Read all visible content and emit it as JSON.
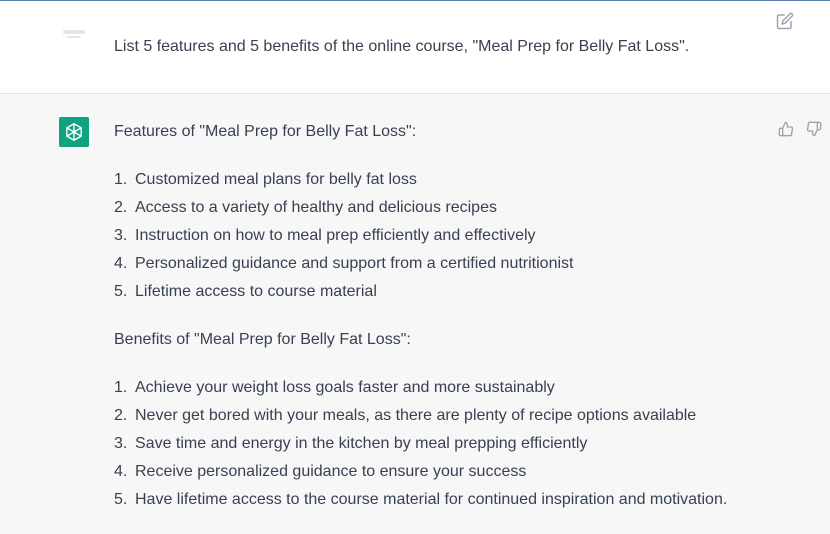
{
  "user_message": {
    "text": "List 5 features and 5 benefits of the online course, \"Meal Prep for Belly Fat Loss\"."
  },
  "assistant_message": {
    "features_heading": "Features of \"Meal Prep for Belly Fat Loss\":",
    "features": [
      {
        "num": "1.",
        "text": "Customized meal plans for belly fat loss"
      },
      {
        "num": "2.",
        "text": "Access to a variety of healthy and delicious recipes"
      },
      {
        "num": "3.",
        "text": "Instruction on how to meal prep efficiently and effectively"
      },
      {
        "num": "4.",
        "text": "Personalized guidance and support from a certified nutritionist"
      },
      {
        "num": "5.",
        "text": "Lifetime access to course material"
      }
    ],
    "benefits_heading": "Benefits of \"Meal Prep for Belly Fat Loss\":",
    "benefits": [
      {
        "num": "1.",
        "text": "Achieve your weight loss goals faster and more sustainably"
      },
      {
        "num": "2.",
        "text": "Never get bored with your meals, as there are plenty of recipe options available"
      },
      {
        "num": "3.",
        "text": "Save time and energy in the kitchen by meal prepping efficiently"
      },
      {
        "num": "4.",
        "text": "Receive personalized guidance to ensure your success"
      },
      {
        "num": "5.",
        "text": "Have lifetime access to the course material for continued inspiration and motivation."
      }
    ]
  },
  "icons": {
    "edit": "edit-icon",
    "thumbs_up": "thumbs-up-icon",
    "thumbs_down": "thumbs-down-icon",
    "assistant_avatar": "openai-logo-icon"
  },
  "colors": {
    "assistant_avatar_bg": "#10a37f",
    "assistant_row_bg": "#f7f7f8",
    "text": "#374151",
    "icon": "#9ca3af"
  }
}
